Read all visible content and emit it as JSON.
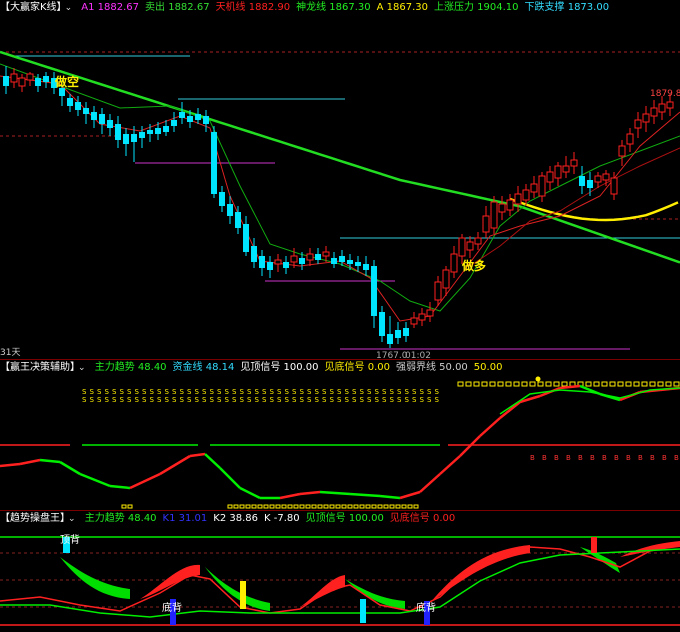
{
  "colors": {
    "bull": "#ff2020",
    "bear": "#00e5ff",
    "ma_green": "#22dd22",
    "ma_yellow": "#ffee00",
    "bg": "#000000",
    "line_main": "#ff2020",
    "line_alt": "#00ee00"
  },
  "main": {
    "title": "【大赢家K线】",
    "chevron": "⌄",
    "stats": [
      {
        "label": "A1",
        "value": "1882.67",
        "color": "#ff33ff"
      },
      {
        "label": "卖出",
        "value": "1882.67",
        "color": "#33dd33"
      },
      {
        "label": "天机线",
        "value": "1882.90",
        "color": "#ff2020"
      },
      {
        "label": "神龙线",
        "value": "1867.30",
        "color": "#22ee22"
      },
      {
        "label": "A",
        "value": "1867.30",
        "color": "#ffee00"
      },
      {
        "label": "上涨压力",
        "value": "1904.10",
        "color": "#22ee22"
      },
      {
        "label": "下跌支撑",
        "value": "1873.00",
        "color": "#33ddff"
      }
    ],
    "label_short": "做空",
    "label_long": "做多",
    "price_high": "1879.8",
    "price_low": "1767.0",
    "low_time": "01:02",
    "period": "31天"
  },
  "sub1": {
    "title": "【赢王决策辅助】",
    "chevron": "⌄",
    "stats": [
      {
        "label": "主力趋势",
        "value": "48.40",
        "color": "#22ee22"
      },
      {
        "label": "资金线",
        "value": "48.14",
        "color": "#33ddff"
      },
      {
        "label": "见顶信号",
        "value": "100.00",
        "color": "#ffffff"
      },
      {
        "label": "见底信号",
        "value": "0.00",
        "color": "#ffee00"
      },
      {
        "label": "强弱界线",
        "value": "50.00",
        "color": "#cccccc"
      },
      {
        "label": "",
        "value": "50.00",
        "color": "#ffee00"
      }
    ],
    "marker_s": "S",
    "marker_b": "B"
  },
  "sub2": {
    "title": "【趋势操盘王】",
    "chevron": "⌄",
    "stats": [
      {
        "label": "主力趋势",
        "value": "48.40",
        "color": "#22ee22"
      },
      {
        "label": "K1",
        "value": "31.01",
        "color": "#3333ff"
      },
      {
        "label": "K2",
        "value": "38.86",
        "color": "#ffffff"
      },
      {
        "label": "K",
        "value": "-7.80",
        "color": "#ffffff"
      },
      {
        "label": "见顶信号",
        "value": "100.00",
        "color": "#22ee22"
      },
      {
        "label": "见底信号",
        "value": "0.00",
        "color": "#ff2020"
      }
    ],
    "top_label": "顶背",
    "bottom_label": "底背"
  }
}
